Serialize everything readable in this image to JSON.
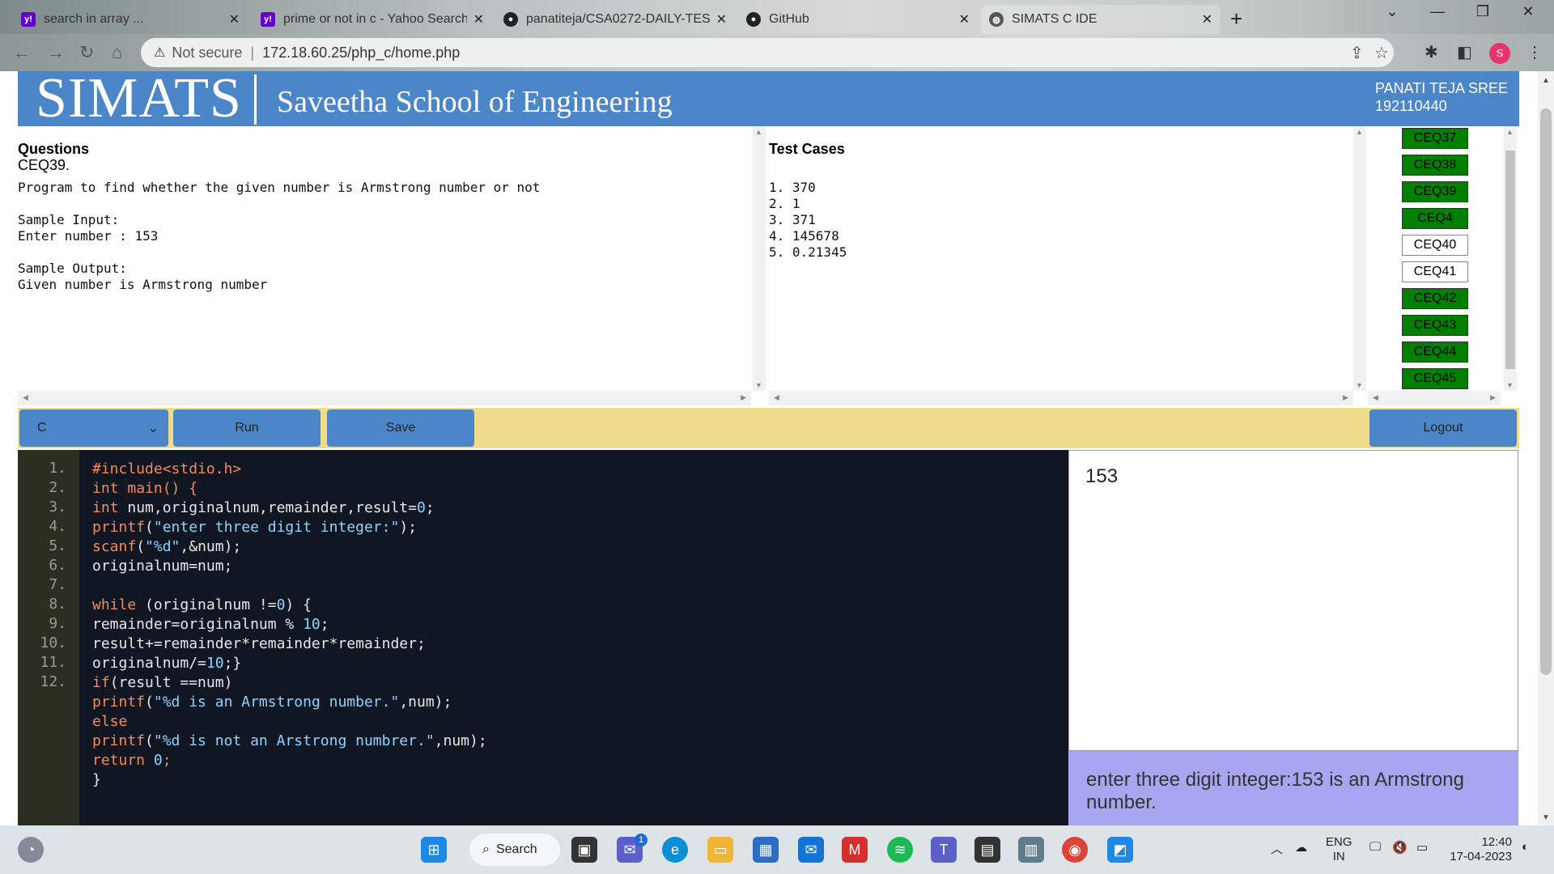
{
  "browser": {
    "tabs": [
      {
        "title": "search in array ...",
        "favicon": "yahoo"
      },
      {
        "title": "prime or not in c - Yahoo Search",
        "favicon": "yahoo"
      },
      {
        "title": "panatiteja/CSA0272-DAILY-TEST-",
        "favicon": "github"
      },
      {
        "title": "GitHub",
        "favicon": "github"
      },
      {
        "title": "SIMATS C IDE",
        "favicon": "globe"
      }
    ],
    "security": "Not secure",
    "url": "172.18.60.25/php_c/home.php",
    "profile_initial": "S"
  },
  "header": {
    "logo": "SIMATS",
    "school": "Saveetha School of Engineering",
    "user_name": "PANATI TEJA SREE",
    "user_id": "192110440"
  },
  "question": {
    "heading": "Questions",
    "id": "CEQ39.",
    "body": "Program to find whether the given number is Armstrong number or not\n\nSample Input:\nEnter number : 153\n\nSample Output:\nGiven number is Armstrong number"
  },
  "testcases": {
    "heading": "Test Cases",
    "items": "1. 370\n2. 1\n3. 371\n4. 145678\n5. 0.21345"
  },
  "question_list": [
    {
      "label": "CEQ37",
      "status": "done"
    },
    {
      "label": "CEQ38",
      "status": "done"
    },
    {
      "label": "CEQ39",
      "status": "done"
    },
    {
      "label": "CEQ4",
      "status": "done"
    },
    {
      "label": "CEQ40",
      "status": "todo"
    },
    {
      "label": "CEQ41",
      "status": "todo"
    },
    {
      "label": "CEQ42",
      "status": "done"
    },
    {
      "label": "CEQ43",
      "status": "done"
    },
    {
      "label": "CEQ44",
      "status": "done"
    },
    {
      "label": "CEQ45",
      "status": "done"
    }
  ],
  "toolbar": {
    "language": "C",
    "run_label": "Run",
    "save_label": "Save",
    "logout_label": "Logout"
  },
  "editor": {
    "line_numbers": [
      "1.",
      "2.",
      "3.",
      "4.",
      "5.",
      "6.",
      "7.",
      "8.",
      "9.",
      "10.",
      "11.",
      "12."
    ],
    "lines": [
      "#include<stdio.h>",
      "int main() {",
      "int num,originalnum,remainder,result=0;",
      "printf(\"enter three digit integer:\");",
      "scanf(\"%d\",&num);",
      "originalnum=num;",
      "",
      "while (originalnum !=0) {",
      "remainder=originalnum % 10;",
      "result+=remainder*remainder*remainder;",
      "originalnum/=10;}",
      "if(result ==num)",
      "printf(\"%d is an Armstrong number.\",num);",
      "else",
      "printf(\"%d is not an Arstrong numbrer.\",num);",
      "return 0;",
      "}"
    ]
  },
  "input_value": "153",
  "output_text": "enter three digit integer:153 is an Armstrong number.",
  "taskbar": {
    "search_label": "Search",
    "chat_badge": "1",
    "lang_top": "ENG",
    "lang_bottom": "IN",
    "time": "12:40",
    "date": "17-04-2023"
  },
  "colors": {
    "header_blue": "#4a86c8",
    "toolbar_yellow": "#efdc8a",
    "done_green": "#008000",
    "result_purple": "#a8a6f0"
  }
}
